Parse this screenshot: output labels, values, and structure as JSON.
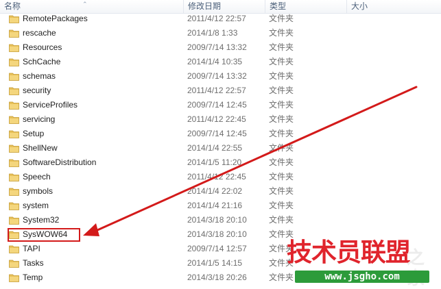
{
  "columns": {
    "name": "名称",
    "date": "修改日期",
    "type": "类型",
    "size": "大小"
  },
  "rows": [
    {
      "name": "RemotePackages",
      "date": "2011/4/12 22:57",
      "type": "文件夹"
    },
    {
      "name": "rescache",
      "date": "2014/1/8 1:33",
      "type": "文件夹"
    },
    {
      "name": "Resources",
      "date": "2009/7/14 13:32",
      "type": "文件夹"
    },
    {
      "name": "SchCache",
      "date": "2014/1/4 10:35",
      "type": "文件夹"
    },
    {
      "name": "schemas",
      "date": "2009/7/14 13:32",
      "type": "文件夹"
    },
    {
      "name": "security",
      "date": "2011/4/12 22:57",
      "type": "文件夹"
    },
    {
      "name": "ServiceProfiles",
      "date": "2009/7/14 12:45",
      "type": "文件夹"
    },
    {
      "name": "servicing",
      "date": "2011/4/12 22:45",
      "type": "文件夹"
    },
    {
      "name": "Setup",
      "date": "2009/7/14 12:45",
      "type": "文件夹"
    },
    {
      "name": "ShellNew",
      "date": "2014/1/4 22:55",
      "type": "文件夹"
    },
    {
      "name": "SoftwareDistribution",
      "date": "2014/1/5 11:20",
      "type": "文件夹"
    },
    {
      "name": "Speech",
      "date": "2011/4/12 22:45",
      "type": "文件夹"
    },
    {
      "name": "symbols",
      "date": "2014/1/4 22:02",
      "type": "文件夹"
    },
    {
      "name": "system",
      "date": "2014/1/4 21:16",
      "type": "文件夹"
    },
    {
      "name": "System32",
      "date": "2014/3/18 20:10",
      "type": "文件夹"
    },
    {
      "name": "SysWOW64",
      "date": "2014/3/18 20:10",
      "type": "文件夹"
    },
    {
      "name": "TAPI",
      "date": "2009/7/14 12:57",
      "type": "文件夹"
    },
    {
      "name": "Tasks",
      "date": "2014/1/5 14:15",
      "type": "文件夹"
    },
    {
      "name": "Temp",
      "date": "2014/3/18 20:26",
      "type": "文件夹"
    }
  ],
  "highlighted_item": "SysWOW64",
  "watermark": {
    "brand": "技术员联盟",
    "ghost": "之家",
    "url": "www.jsgho.com"
  },
  "icons": {
    "folder": "folder-icon",
    "sort": "sort-caret-icon"
  },
  "colors": {
    "highlight": "#d31a1a",
    "arrow": "#d31a1a",
    "brand_red": "#e0242c",
    "url_bg": "#2c9b3a",
    "folder": "#e8c15a"
  }
}
